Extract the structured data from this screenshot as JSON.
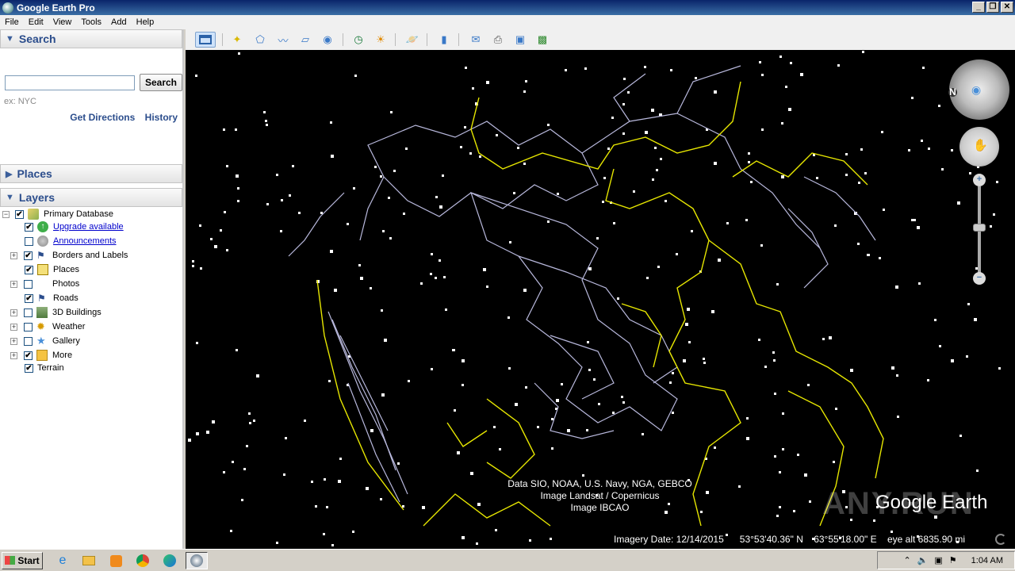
{
  "window": {
    "title": "Google Earth Pro"
  },
  "menu": [
    "File",
    "Edit",
    "View",
    "Tools",
    "Add",
    "Help"
  ],
  "search": {
    "header": "Search",
    "button": "Search",
    "placeholder": "",
    "hint": "ex: NYC",
    "get_directions": "Get Directions",
    "history": "History"
  },
  "places": {
    "header": "Places"
  },
  "layers": {
    "header": "Layers",
    "items": [
      {
        "label": "Primary Database",
        "checked": true,
        "link": false
      },
      {
        "label": "Upgrade available",
        "checked": true,
        "link": true
      },
      {
        "label": "Announcements",
        "checked": false,
        "link": true
      },
      {
        "label": "Borders and Labels",
        "checked": true,
        "link": false
      },
      {
        "label": "Places",
        "checked": true,
        "link": false
      },
      {
        "label": "Photos",
        "checked": false,
        "link": false
      },
      {
        "label": "Roads",
        "checked": true,
        "link": false
      },
      {
        "label": "3D Buildings",
        "checked": false,
        "link": false
      },
      {
        "label": "Weather",
        "checked": false,
        "link": false
      },
      {
        "label": "Gallery",
        "checked": false,
        "link": false
      },
      {
        "label": "More",
        "checked": true,
        "link": false
      },
      {
        "label": "Terrain",
        "checked": true,
        "link": false
      }
    ]
  },
  "map": {
    "attribution": [
      "Data SIO, NOAA, U.S. Navy, NGA, GEBCO",
      "Image Landsat / Copernicus",
      "Image IBCAO"
    ],
    "imagery_date": "Imagery Date: 12/14/2015",
    "latitude": "53°53'40.36\" N",
    "longitude": "63°55'18.00\" E",
    "eye_alt": "eye alt 6835.90 mi",
    "logo": "Google Earth",
    "watermark": "ANY.RUN",
    "compass_letter": "N"
  },
  "taskbar": {
    "start": "Start",
    "clock": "1:04 AM"
  }
}
